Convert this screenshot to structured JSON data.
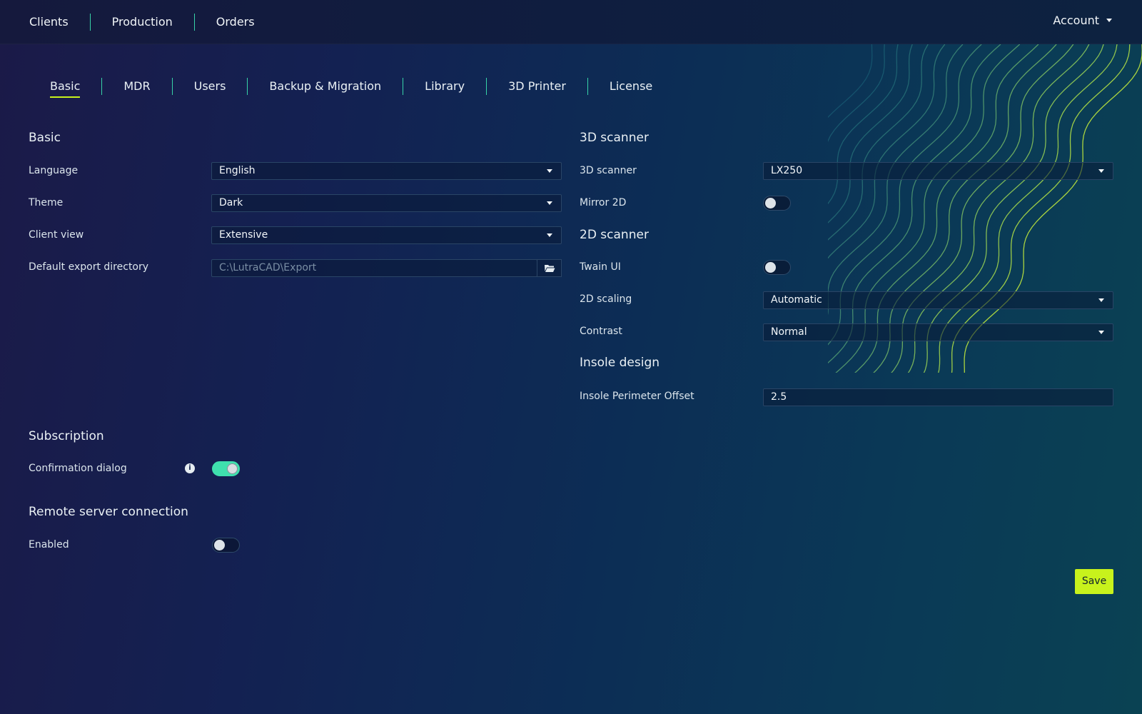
{
  "topnav": {
    "items": [
      "Clients",
      "Production",
      "Orders"
    ],
    "account": "Account"
  },
  "tabs": [
    "Basic",
    "MDR",
    "Users",
    "Backup & Migration",
    "Library",
    "3D Printer",
    "License"
  ],
  "active_tab": "Basic",
  "basic": {
    "title": "Basic",
    "language_label": "Language",
    "language_value": "English",
    "theme_label": "Theme",
    "theme_value": "Dark",
    "client_view_label": "Client view",
    "client_view_value": "Extensive",
    "export_dir_label": "Default export directory",
    "export_dir_placeholder": "C:\\LutraCAD\\Export"
  },
  "subscription": {
    "title": "Subscription",
    "confirmation_label": "Confirmation dialog",
    "confirmation_enabled": true
  },
  "remote": {
    "title": "Remote server connection",
    "enabled_label": "Enabled",
    "enabled": false
  },
  "scanner3d": {
    "title": "3D scanner",
    "scanner_label": "3D scanner",
    "scanner_value": "LX250",
    "mirror_label": "Mirror 2D",
    "mirror_enabled": false
  },
  "scanner2d": {
    "title": "2D scanner",
    "twain_label": "Twain UI",
    "twain_enabled": false,
    "scaling_label": "2D scaling",
    "scaling_value": "Automatic",
    "contrast_label": "Contrast",
    "contrast_value": "Normal"
  },
  "insole": {
    "title": "Insole design",
    "offset_label": "Insole Perimeter Offset",
    "offset_value": "2.5"
  },
  "save_label": "Save",
  "colors": {
    "accent": "#c8f21c",
    "toggle_on": "#3fe0ae",
    "separator": "#37d3a8"
  }
}
